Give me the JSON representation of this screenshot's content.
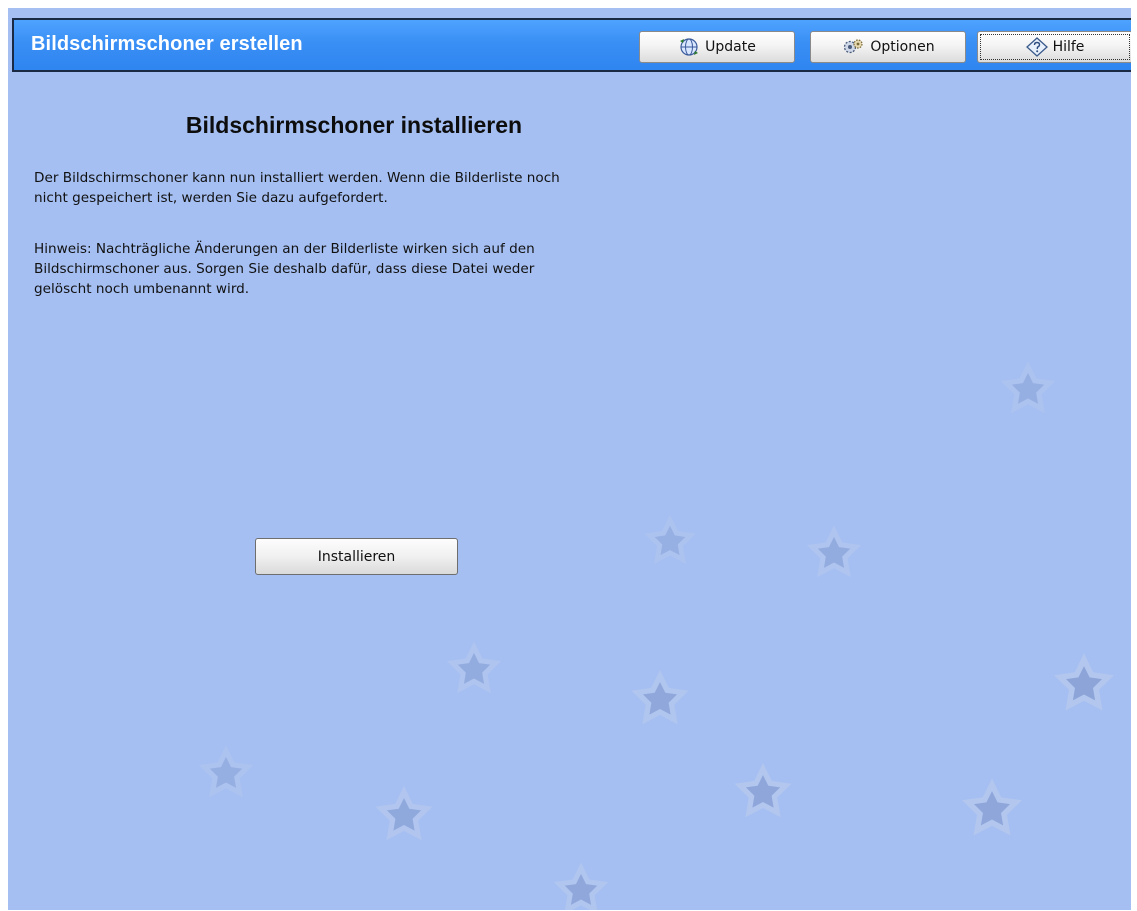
{
  "header": {
    "title": "Bildschirmschoner erstellen",
    "buttons": {
      "update": "Update",
      "optionen": "Optionen",
      "hilfe": "Hilfe"
    }
  },
  "main": {
    "heading": "Bildschirmschoner installieren",
    "paragraph1": "Der Bildschirmschoner kann nun installiert werden. Wenn die Bilderliste noch\nnicht gespeichert ist, werden Sie dazu aufgefordert.",
    "paragraph2": "Hinweis: Nachträgliche Änderungen an der Bilderliste wirken sich auf den\nBildschirmschoner aus. Sorgen Sie deshalb dafür, dass diese Datei weder\ngelöscht noch umbenannt wird.",
    "install_button": "Installieren"
  },
  "icons": {
    "update": "globe-update-icon",
    "optionen": "options-gear-icon",
    "hilfe": "help-diamond-icon",
    "background": "star-icon"
  },
  "colors": {
    "titlebar": "#3a8ff5",
    "background": "#a5bff2",
    "star": "#8ea5d6"
  }
}
